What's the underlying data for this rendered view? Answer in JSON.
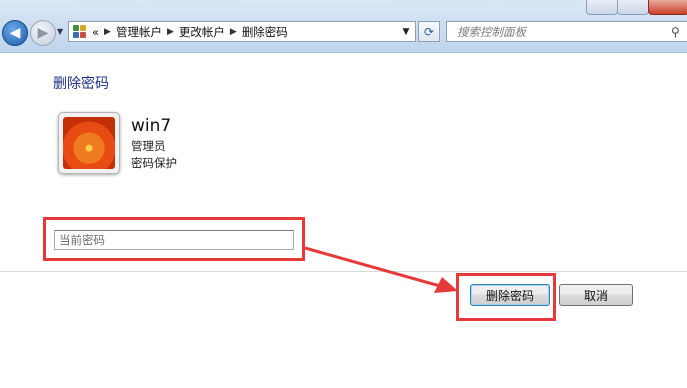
{
  "colors": {
    "accent_title": "#1e3287",
    "annotation_red": "#e63a3a",
    "toolbar_bg": "#c9dcf1"
  },
  "navigation": {
    "back_icon": "back-arrow-icon",
    "forward_icon": "forward-arrow-icon",
    "history_icon": "history-dropdown-icon"
  },
  "address_bar": {
    "lead": "«",
    "breadcrumb": [
      "管理帐户",
      "更改帐户",
      "删除密码"
    ],
    "separator": "▶",
    "dropdown_glyph": "▼",
    "refresh_glyph": "⟳"
  },
  "search": {
    "placeholder": "搜索控制面板",
    "icon_glyph": "⚲"
  },
  "page": {
    "title": "删除密码",
    "user": {
      "name": "win7",
      "role": "管理员",
      "status": "密码保护"
    },
    "password_field": {
      "placeholder": "当前密码",
      "value": ""
    },
    "buttons": {
      "delete_label": "删除密码",
      "cancel_label": "取消"
    }
  }
}
